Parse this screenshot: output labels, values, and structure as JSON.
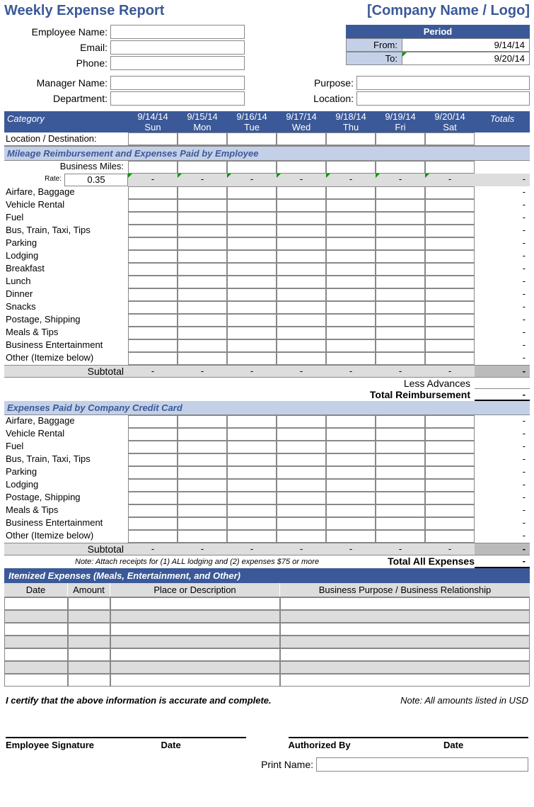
{
  "header": {
    "title": "Weekly Expense Report",
    "company": "[Company Name / Logo]"
  },
  "employee": {
    "name_label": "Employee Name:",
    "email_label": "Email:",
    "phone_label": "Phone:",
    "manager_label": "Manager Name:",
    "dept_label": "Department:"
  },
  "period": {
    "header": "Period",
    "from_label": "From:",
    "from_value": "9/14/14",
    "to_label": "To:",
    "to_value": "9/20/14"
  },
  "right_info": {
    "purpose_label": "Purpose:",
    "location_label": "Location:"
  },
  "category_header": {
    "category": "Category",
    "totals": "Totals",
    "days": [
      {
        "date": "9/14/14",
        "name": "Sun"
      },
      {
        "date": "9/15/14",
        "name": "Mon"
      },
      {
        "date": "9/16/14",
        "name": "Tue"
      },
      {
        "date": "9/17/14",
        "name": "Wed"
      },
      {
        "date": "9/18/14",
        "name": "Thu"
      },
      {
        "date": "9/19/14",
        "name": "Fri"
      },
      {
        "date": "9/20/14",
        "name": "Sat"
      }
    ]
  },
  "location_row": "Location / Destination:",
  "section1": {
    "title": "Mileage Reimbursement and Expenses Paid by Employee",
    "miles_label": "Business Miles:",
    "rate_label": "Rate:",
    "rate_value": "0.35",
    "dash": "-",
    "categories": [
      "Airfare, Baggage",
      "Vehicle Rental",
      "Fuel",
      "Bus, Train, Taxi, Tips",
      "Parking",
      "Lodging",
      "Breakfast",
      "Lunch",
      "Dinner",
      "Snacks",
      "Postage, Shipping",
      "Meals & Tips",
      "Business Entertainment",
      "Other (Itemize below)"
    ],
    "subtotal": "Subtotal",
    "less_advances": "Less Advances",
    "total_reimbursement": "Total Reimbursement"
  },
  "section2": {
    "title": "Expenses Paid by Company Credit Card",
    "categories": [
      "Airfare, Baggage",
      "Vehicle Rental",
      "Fuel",
      "Bus, Train, Taxi, Tips",
      "Parking",
      "Lodging",
      "Postage, Shipping",
      "Meals & Tips",
      "Business Entertainment",
      "Other (Itemize below)"
    ],
    "subtotal": "Subtotal",
    "note": "Note:  Attach receipts for (1) ALL lodging and (2) expenses $75 or more",
    "total_all": "Total All Expenses"
  },
  "itemized": {
    "title": "Itemized Expenses (Meals, Entertainment, and Other)",
    "h_date": "Date",
    "h_amount": "Amount",
    "h_place": "Place or Description",
    "h_purpose": "Business Purpose / Business Relationship"
  },
  "footer": {
    "cert": "I certify that the above information is accurate and complete.",
    "note": "Note: All amounts listed in USD",
    "emp_sig": "Employee Signature",
    "date": "Date",
    "auth_by": "Authorized By",
    "print_name": "Print Name:"
  }
}
